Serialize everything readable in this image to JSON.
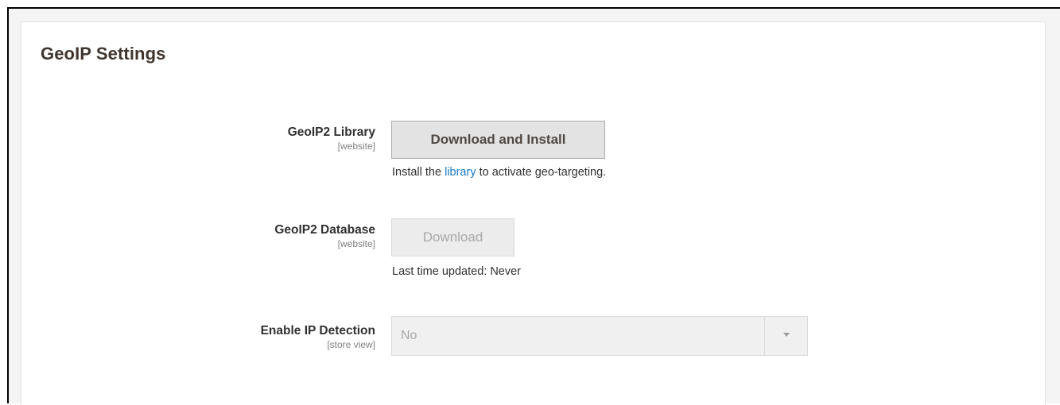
{
  "section": {
    "title": "GeoIP Settings"
  },
  "fields": {
    "library": {
      "label": "GeoIP2 Library",
      "scope": "[website]",
      "button_label": "Download and Install",
      "note_before": "Install the ",
      "note_link": "library",
      "note_after": " to activate geo-targeting."
    },
    "database": {
      "label": "GeoIP2 Database",
      "scope": "[website]",
      "button_label": "Download",
      "note": "Last time updated: Never"
    },
    "ip_detection": {
      "label": "Enable IP Detection",
      "scope": "[store view]",
      "selected_value": "No"
    }
  },
  "icons": {
    "select_arrow": "chevron-down-icon"
  },
  "colors": {
    "link": "#1979c3",
    "button_bg": "#e3e3e3",
    "disabled_text": "#a9a9a9"
  }
}
